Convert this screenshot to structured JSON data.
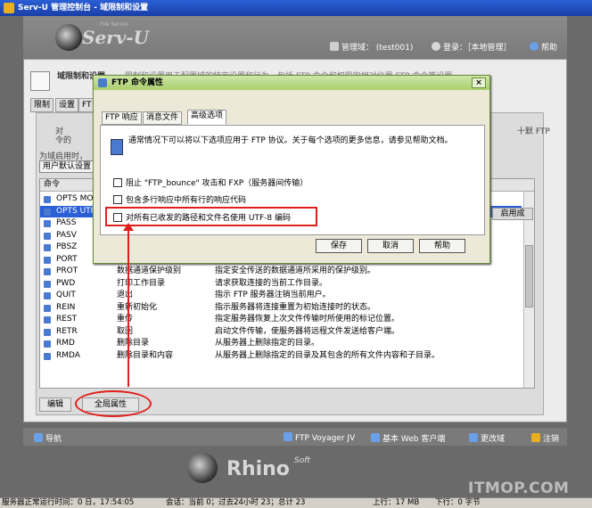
{
  "app": {
    "title": "Serv-U 管理控制台 - 域限制和设置"
  },
  "header": {
    "logo_brand": "Serv-U",
    "logo_tag": "File Server",
    "admin_label": "管理域： (test001)",
    "login_label": "登录：［本地管理］",
    "help_label": "帮助"
  },
  "page": {
    "heading": "域限制和设置",
    "description": "限制和设置用于配置域的特定设置和行为。包括 FTP 命令和权限的相对位置 FTP 命令等设置"
  },
  "main_tabs": [
    "限制",
    "设置",
    "FT"
  ],
  "inner": {
    "text1": "对",
    "text2": "令的",
    "text3": "为域启用时，",
    "right_text": "十默 FTP",
    "user_default": "用户默认设置"
  },
  "table": {
    "header": "命令",
    "rows": [
      {
        "name": "OPTS MODE",
        "desc": "",
        "detail": ""
      },
      {
        "name": "OPTS UTF8",
        "desc": "",
        "detail": ""
      },
      {
        "name": "PASS",
        "desc": "",
        "detail": ""
      },
      {
        "name": "PASV",
        "desc": "",
        "detail": ""
      },
      {
        "name": "PBSZ",
        "desc": "",
        "detail": ""
      },
      {
        "name": "PORT",
        "desc": "数据端口",
        "detail": "指定服务器为了传输数据应连接的 IP 地址和端口。"
      },
      {
        "name": "PROT",
        "desc": "数据通道保护级别",
        "detail": "指定安全传送的数据通道所采用的保护级别。"
      },
      {
        "name": "PWD",
        "desc": "打印工作目录",
        "detail": "请求获取连接的当前工作目录。"
      },
      {
        "name": "QUIT",
        "desc": "退出",
        "detail": "指示 FTP 服务器注销当前用户。"
      },
      {
        "name": "REIN",
        "desc": "重新初始化",
        "detail": "指示服务器将连接重置为初始连接时的状态。"
      },
      {
        "name": "REST",
        "desc": "重传",
        "detail": "指定服务器恢复上次文件传输时所使用的标记位置。"
      },
      {
        "name": "RETR",
        "desc": "取回",
        "detail": "启动文件传输，使服务器将远程文件发送给客户端。"
      },
      {
        "name": "RMD",
        "desc": "删除目录",
        "detail": "从服务器上删除指定的目录。"
      },
      {
        "name": "RMDA",
        "desc": "删除目录和内容",
        "detail": "从服务器上删除指定的目录及其包含的所有文件内容和子目录。"
      }
    ],
    "enable_button": "启用成"
  },
  "buttons": {
    "edit": "编辑",
    "global": "全局属性"
  },
  "bottom_nav": {
    "nav": "导航",
    "voyager": "FTP Voyager JV",
    "web_client": "基本 Web 客户端",
    "change_domain": "更改域",
    "logout": "注销"
  },
  "footer": {
    "brand": "Rhino",
    "soft": "Soft"
  },
  "statusbar": {
    "uptime": "服务器正常运行时间：0 日，17:54:05",
    "sessions": "会话：当前 0；过去24小时 23；总计 23",
    "upload": "上行：17 MB",
    "download": "下行：0 字节"
  },
  "watermark": "ITMOP.COM",
  "dialog": {
    "title": "FTP 命令属性",
    "close": "×",
    "tabs": [
      "FTP 响应",
      "消息文件",
      "高级选项"
    ],
    "info": "通常情况下可以将以下选项应用于 FTP 协议。关于每个选项的更多信息，请参见帮助文档。",
    "options": [
      {
        "label": "阻止 \"FTP_bounce\" 攻击和 FXP（服务器间传输）",
        "checked": false
      },
      {
        "label": "包含多行响应中所有行的响应代码",
        "checked": false
      },
      {
        "label": "对所有已收发的路径和文件名使用 UTF-8 编码",
        "checked": false
      }
    ],
    "save": "保存",
    "cancel": "取消",
    "help": "帮助"
  },
  "colors": {
    "highlight": "#e0201c",
    "titlebar": "#1a3fa6",
    "dialog_title": "#a9cf6c"
  }
}
